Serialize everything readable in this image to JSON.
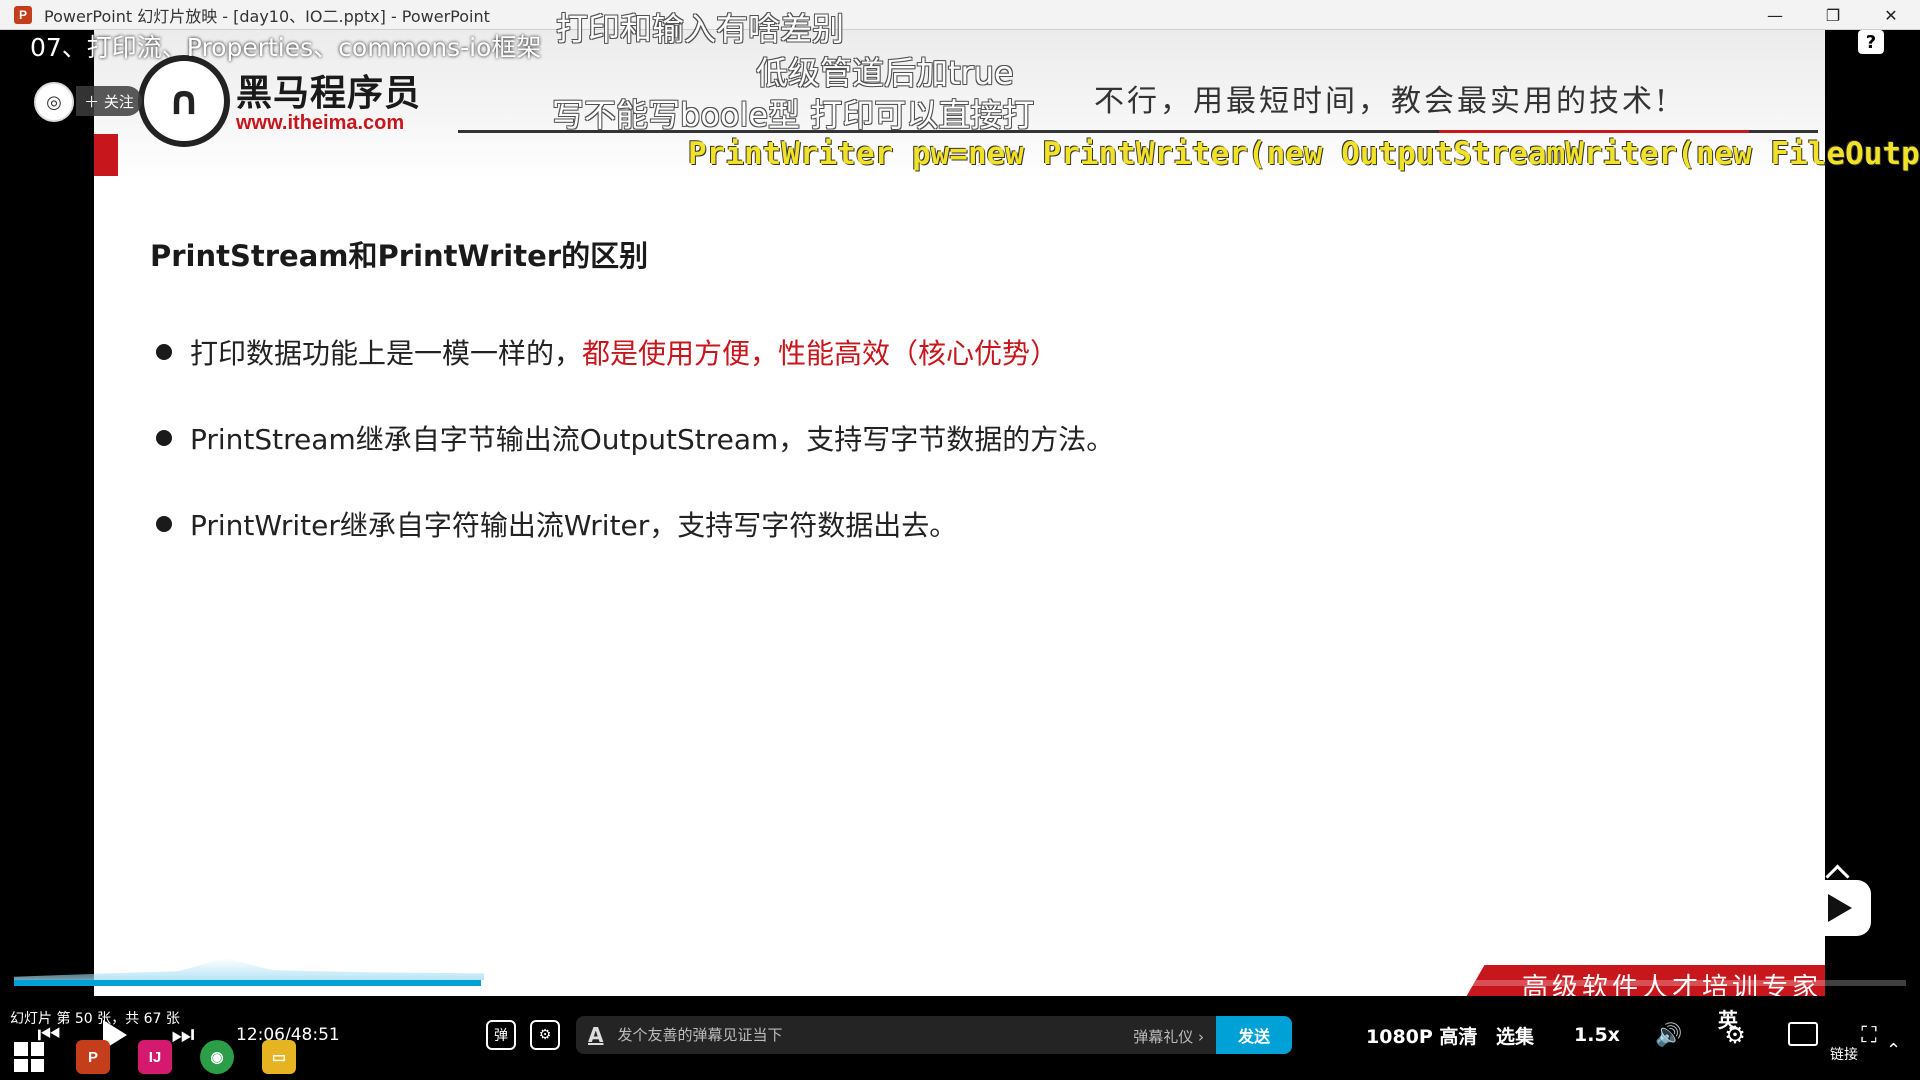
{
  "window": {
    "app_icon": "P",
    "title": "PowerPoint 幻灯片放映 - [day10、IO二.pptx] - PowerPoint",
    "minimize": "—",
    "restore": "❐",
    "close": "✕"
  },
  "slide": {
    "logo_name": "黑马程序员",
    "logo_url": "www.itheima.com",
    "slogan": "不行，用最短时间，教会最实用的技术!",
    "heading": "PrintStream和PrintWriter的区别",
    "bullets": [
      {
        "text": "打印数据功能上是一模一样的，",
        "highlight": "都是使用方便，性能高效（核心优势）"
      },
      {
        "text": "PrintStream继承自字节输出流OutputStream，支持写字节数据的方法。",
        "highlight": ""
      },
      {
        "text": "PrintWriter继承自字符输出流Writer，支持写字符数据出去。",
        "highlight": ""
      }
    ],
    "banner": "高级软件人才培训专家"
  },
  "video": {
    "title": "07、打印流、Properties、commons-io框架",
    "follow_label": "＋ 关注",
    "help_label": "?",
    "danmaku": [
      "打印和输入有啥差别",
      "低级管道后加true",
      "写不能写boole型 打印可以直接打",
      "PrintWriter pw=new PrintWriter(new OutputStreamWriter(new FileOutput"
    ],
    "progress": 0.247,
    "current_time": "12:06",
    "time_separator": " / ",
    "total_time": "48:51",
    "danmaku_toggle_label": "弹",
    "danmaku_settings_label": "⚙",
    "danmaku_placeholder": "发个友善的弹幕见证当下",
    "danmaku_etiquette": "弹幕礼仪 ›",
    "send_label": "发送",
    "quality_label": "1080P 高清",
    "episodes_label": "选集",
    "speed_label": "1.5x",
    "volume_icon": "🔊",
    "settings_icon": "⚙",
    "fullscreen_icon": "⛶",
    "prev_icon": "⏮",
    "next_icon": "⏭"
  },
  "ppt_status": "幻灯片 第 50 张，共 67 张",
  "taskbar": {
    "apps": [
      {
        "name": "powerpoint",
        "glyph": "P",
        "color": "#c43e1c"
      },
      {
        "name": "intellij",
        "glyph": "IJ",
        "color": "#d41a6e"
      },
      {
        "name": "chrome",
        "glyph": "◉",
        "color": "#2c9e47"
      },
      {
        "name": "explorer",
        "glyph": "▭",
        "color": "#e6b422"
      }
    ],
    "ime_label": "英",
    "tray_text": "链接",
    "tray_chevron": "⌃"
  }
}
